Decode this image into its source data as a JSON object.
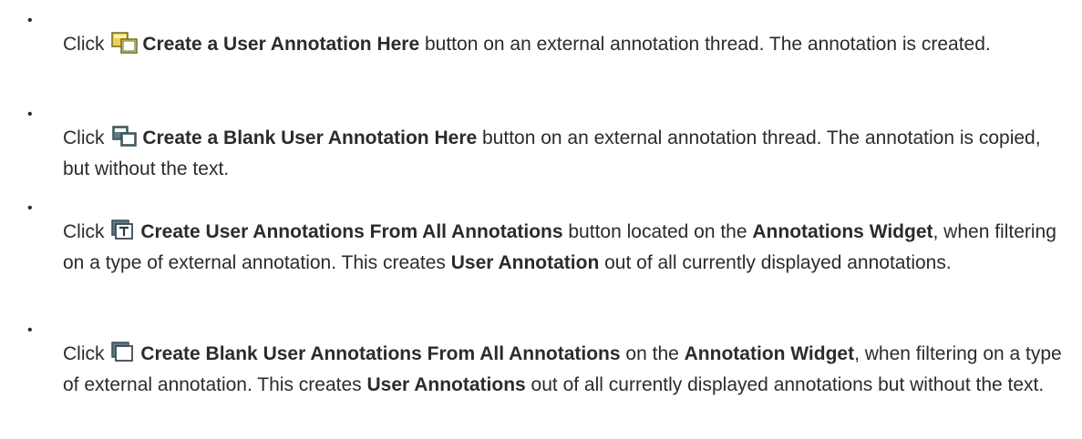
{
  "items": [
    {
      "click": "Click",
      "icon": "create-user-annotation-icon",
      "action": "Create a User Annotation Here",
      "t1": " button on an external annotation thread. The annotation is created."
    },
    {
      "click": "Click",
      "icon": "create-blank-user-annotation-icon",
      "action": "Create a Blank User Annotation Here",
      "t1": " button on an external annotation thread. The annotation is copied, but without the text."
    },
    {
      "click": "Click",
      "icon": "create-user-annotations-from-all-icon",
      "action": "Create User Annotations From All Annotations",
      "t1": " button located on the ",
      "k1": "Annotations Widget",
      "t2": ", when filtering on a type of external annotation. This creates ",
      "k2": "User Annotation",
      "t3": " out of all currently displayed annotations."
    },
    {
      "click": "Click",
      "icon": "create-blank-user-annotations-from-all-icon",
      "action": "Create Blank User Annotations From All Annotations",
      "t1": " on the ",
      "k1": "Annotation Widget",
      "t2": ", when filtering on a type of external annotation. This creates ",
      "k2": "User Annotations",
      "t3": " out of all currently displayed annotations but without the text."
    }
  ],
  "bullet_char": "•"
}
